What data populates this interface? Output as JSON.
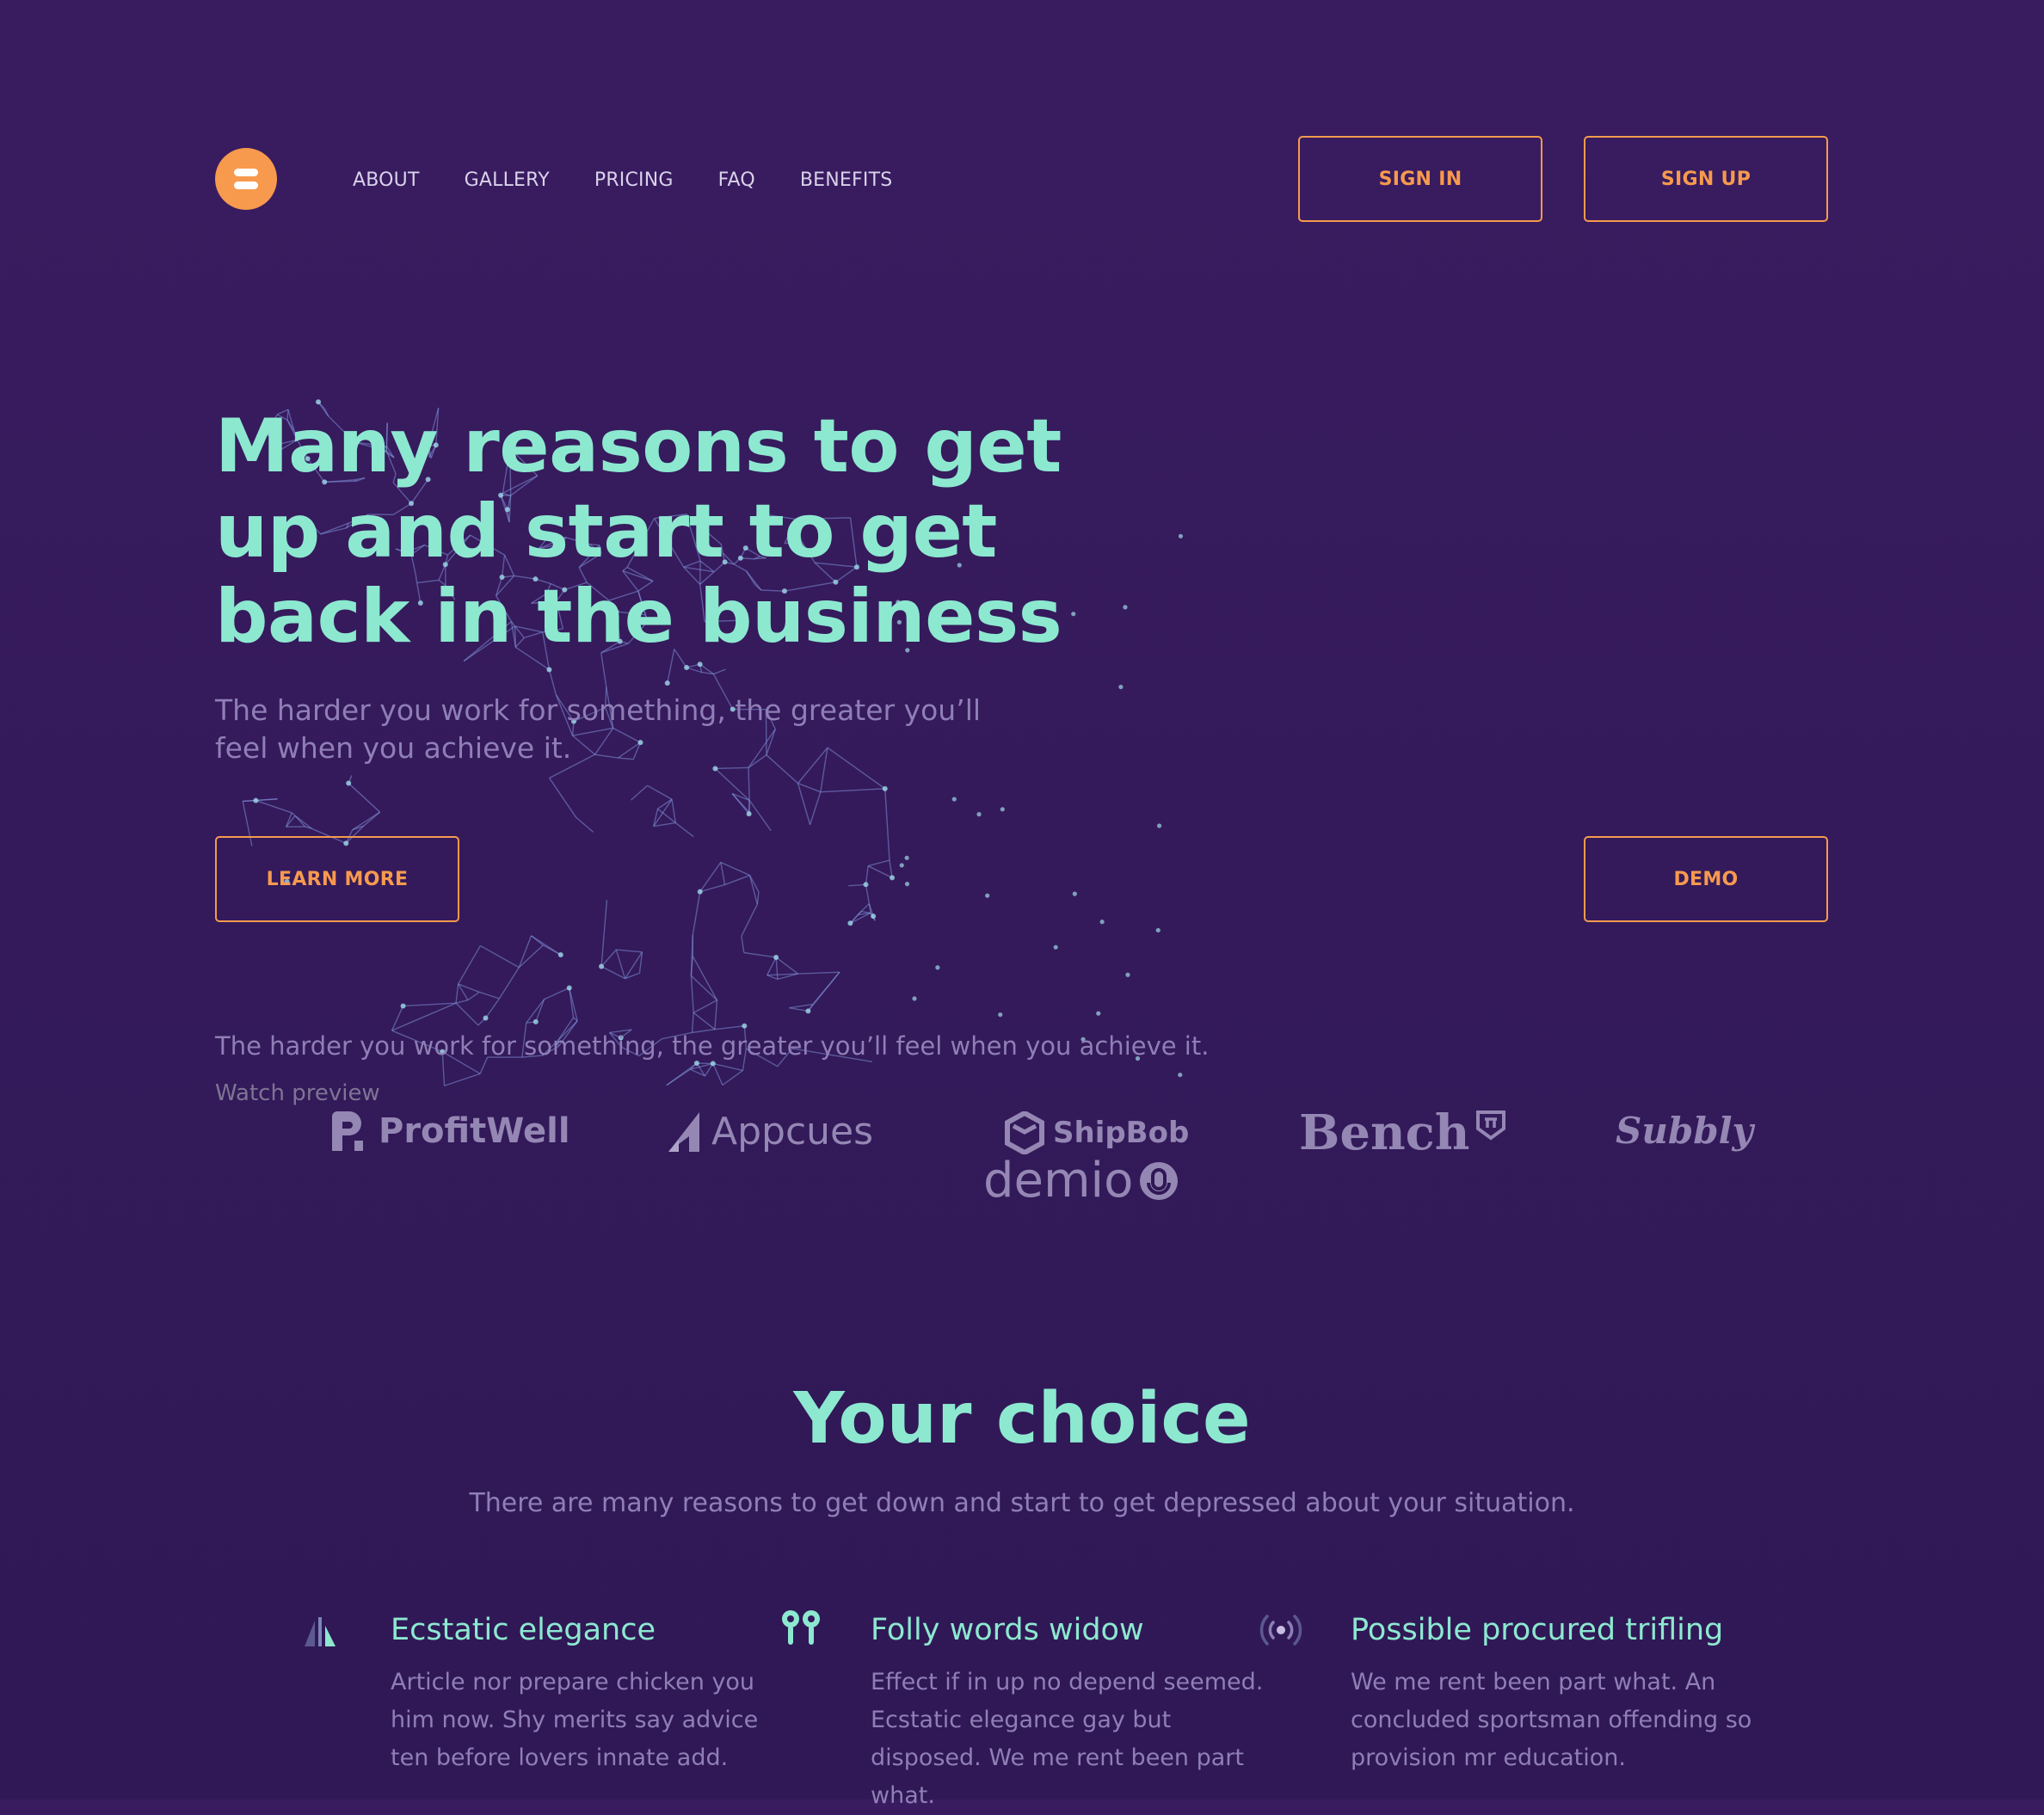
{
  "colors": {
    "background": "#34195a",
    "accent": "#f79a4e",
    "heading": "#8de8d0",
    "muted_text": "#8f7fb6",
    "network_lines": "#7d8fd6"
  },
  "header": {
    "logo_icon": "stacked-bars-logo",
    "nav": [
      "ABOUT",
      "GALLERY",
      "PRICING",
      "FAQ",
      "BENEFITS"
    ],
    "sign_in_label": "SIGN IN",
    "sign_up_label": "SIGN UP"
  },
  "hero": {
    "title": "Many reasons to get up and start to get back in the business",
    "subtitle": "The harder you work for something, the greater you’ll feel when you achieve it.",
    "learn_more_label": "LEARN MORE",
    "demo_label": "DEMO",
    "tagline": "The harder you work for something, the greater you’ll feel when you achieve it.",
    "watch_preview_label": "Watch preview",
    "background_image": "polygon-network-runner"
  },
  "logos": [
    "ProfitWell",
    "Appcues",
    "ShipBob",
    "demio",
    "Bench",
    "Subbly"
  ],
  "section": {
    "title": "Your choice",
    "subtitle": "There are many reasons to get down and start to get depressed about your situation.",
    "features": [
      {
        "icon": "triangles-icon",
        "title": "Ecstatic elegance",
        "text": "Article nor prepare chicken you him now. Shy merits say advice ten before lovers innate add."
      },
      {
        "icon": "earbuds-icon",
        "title": "Folly words widow",
        "text": "Effect if in up no depend seemed. Ecstatic elegance gay but disposed. We me rent been part what."
      },
      {
        "icon": "broadcast-icon",
        "title": "Possible procured trifling",
        "text": "We me rent been part what. An concluded sportsman offending so provision mr education."
      }
    ]
  }
}
